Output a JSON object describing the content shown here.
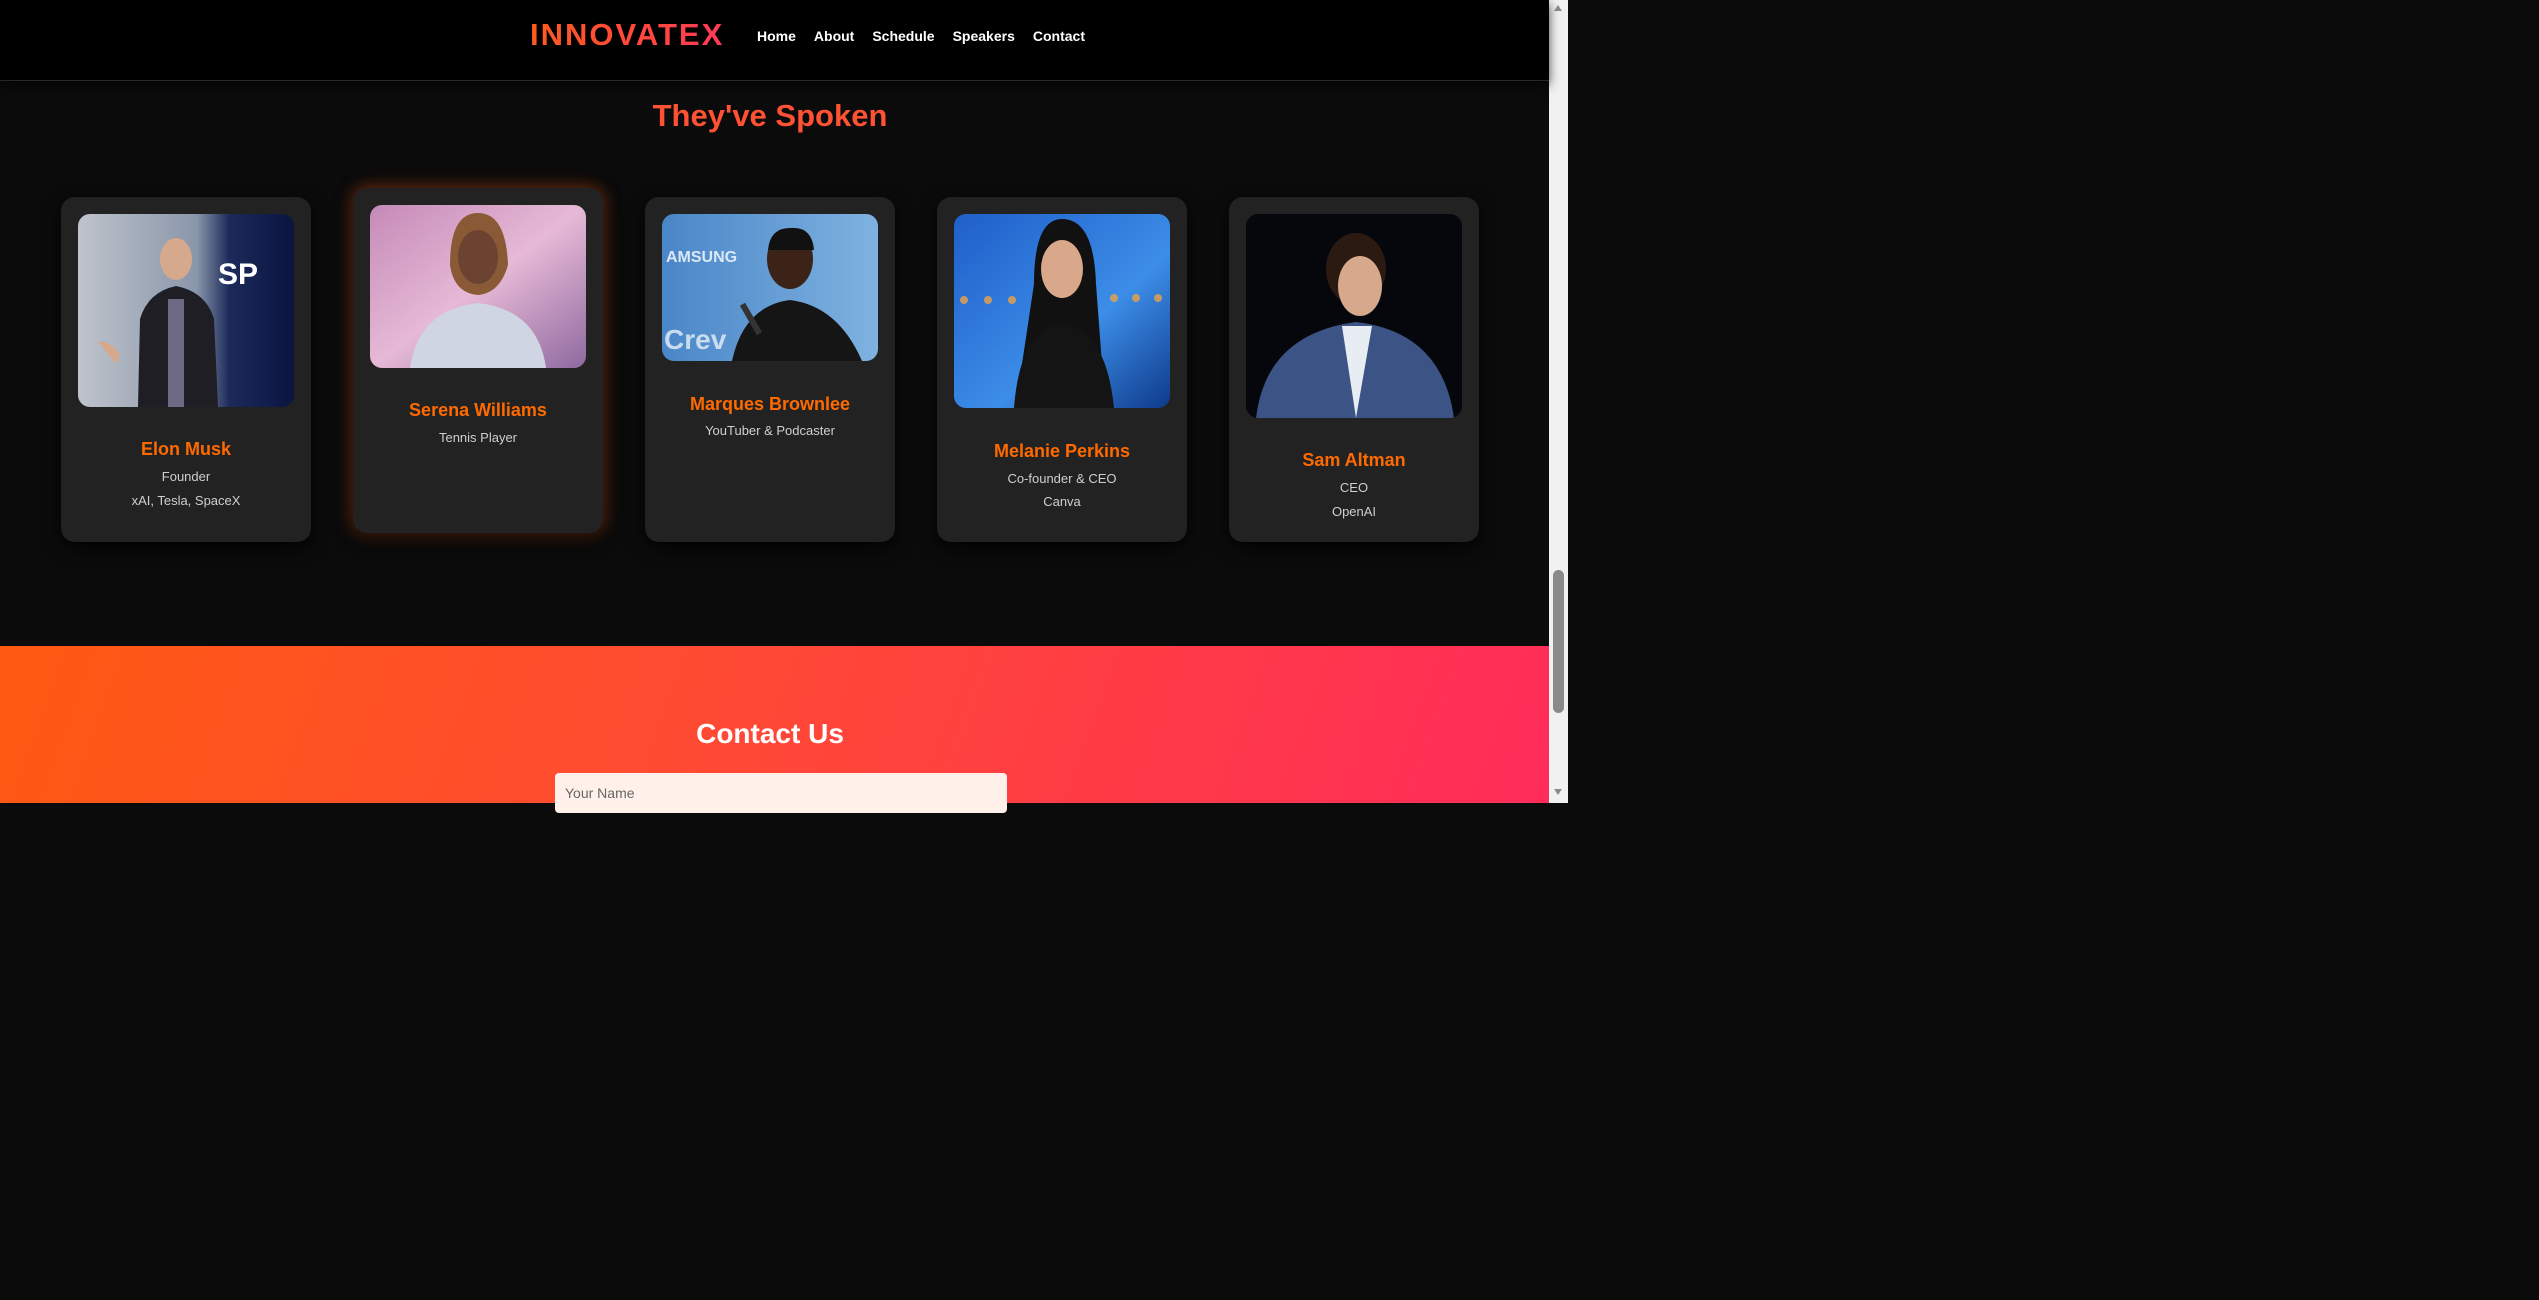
{
  "nav": {
    "logo": "INNOVATEX",
    "links": [
      "Home",
      "About",
      "Schedule",
      "Speakers",
      "Contact"
    ]
  },
  "speakers_section": {
    "title": "They've Spoken",
    "speakers": [
      {
        "name": "Elon Musk",
        "role": "Founder",
        "org": "xAI, Tesla, SpaceX"
      },
      {
        "name": "Serena Williams",
        "role": "Tennis Player"
      },
      {
        "name": "Marques Brownlee",
        "role": "YouTuber & Podcaster"
      },
      {
        "name": "Melanie Perkins",
        "role": "Co-founder & CEO",
        "org": "Canva"
      },
      {
        "name": "Sam Altman",
        "role": "CEO",
        "org": "OpenAI"
      }
    ]
  },
  "contact": {
    "title": "Contact Us",
    "name_placeholder": "Your Name"
  },
  "colors": {
    "accent": "#ff6a00",
    "title": "#ff5133",
    "card_bg": "#222222",
    "page_bg": "#0b0b0b"
  }
}
